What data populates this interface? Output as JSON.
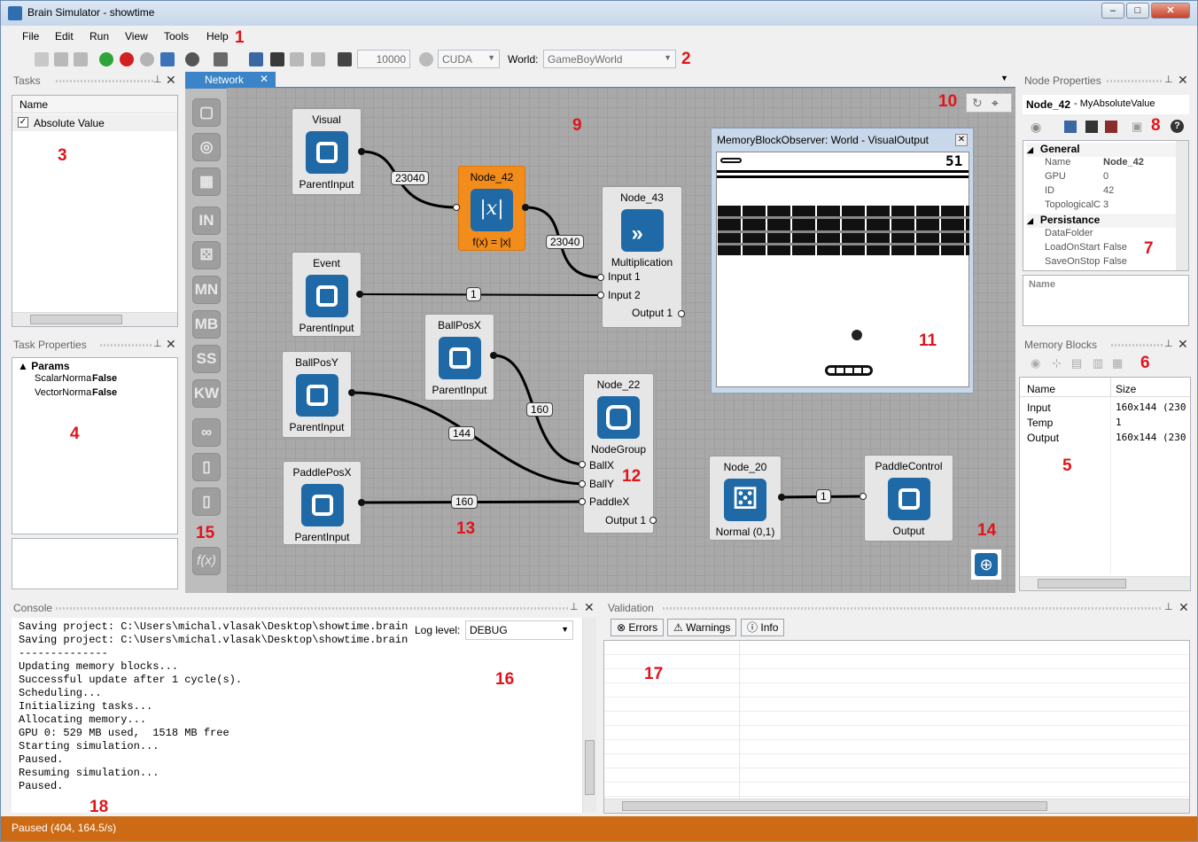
{
  "window": {
    "title": "Brain Simulator - showtime"
  },
  "menu": [
    "File",
    "Edit",
    "Run",
    "View",
    "Tools",
    "Help"
  ],
  "toolbar": {
    "steps": "10000",
    "device": "CUDA",
    "world_label": "World:",
    "world": "GameBoyWorld"
  },
  "tasks": {
    "title": "Tasks",
    "col": "Name",
    "items": [
      {
        "label": "Absolute Value",
        "checked": true
      }
    ]
  },
  "task_props": {
    "title": "Task Properties",
    "group": "Params",
    "rows": [
      {
        "k": "ScalarNorma",
        "v": "False"
      },
      {
        "k": "VectorNorma",
        "v": "False"
      }
    ]
  },
  "doc_tab": {
    "label": "Network"
  },
  "library": [
    "IN",
    "MN",
    "MB",
    "SS",
    "KW"
  ],
  "nodes": {
    "visual": {
      "title": "Visual",
      "label": "ParentInput"
    },
    "event": {
      "title": "Event",
      "label": "ParentInput"
    },
    "ballposy": {
      "title": "BallPosY",
      "label": "ParentInput"
    },
    "ballposx": {
      "title": "BallPosX",
      "label": "ParentInput"
    },
    "paddleposx": {
      "title": "PaddlePosX",
      "label": "ParentInput"
    },
    "n42": {
      "title": "Node_42",
      "label": "f(x) = |x|",
      "icon": "|x|"
    },
    "n43": {
      "title": "Node_43",
      "label": "Multiplication",
      "in1": "Input 1",
      "in2": "Input 2",
      "out": "Output 1"
    },
    "n22": {
      "title": "Node_22",
      "label": "NodeGroup",
      "in1": "BallX",
      "in2": "BallY",
      "in3": "PaddleX",
      "out": "Output 1"
    },
    "n20": {
      "title": "Node_20",
      "label": "Normal (0,1)"
    },
    "paddlecontrol": {
      "title": "PaddleControl",
      "label": "Output"
    }
  },
  "edges": [
    "23040",
    "23040",
    "1",
    "160",
    "144",
    "160",
    "1"
  ],
  "observer": {
    "title": "MemoryBlockObserver: World - VisualOutput",
    "score": "51"
  },
  "node_props": {
    "title": "Node Properties",
    "node": "Node_42",
    "type": " - MyAbsoluteValue",
    "groups": [
      {
        "name": "General",
        "rows": [
          {
            "k": "Name",
            "v": "Node_42",
            "bold": true
          },
          {
            "k": "GPU",
            "v": "0"
          },
          {
            "k": "ID",
            "v": "42"
          },
          {
            "k": "TopologicalC",
            "v": "3"
          }
        ]
      },
      {
        "name": "Persistance",
        "rows": [
          {
            "k": "DataFolder",
            "v": ""
          },
          {
            "k": "LoadOnStart",
            "v": "False"
          },
          {
            "k": "SaveOnStop",
            "v": "False"
          }
        ]
      }
    ],
    "desc_label": "Name"
  },
  "memory": {
    "title": "Memory Blocks",
    "cols": [
      "Name",
      "Size"
    ],
    "rows": [
      {
        "n": "Input",
        "s": "160x144 (230"
      },
      {
        "n": "Temp",
        "s": "1"
      },
      {
        "n": "Output",
        "s": "160x144 (230"
      }
    ]
  },
  "console": {
    "title": "Console",
    "log_label": "Log level:",
    "log_level": "DEBUG",
    "lines": "Saving project: C:\\Users\\michal.vlasak\\Desktop\\showtime.brain\nSaving project: C:\\Users\\michal.vlasak\\Desktop\\showtime.brain\n--------------\nUpdating memory blocks...\nSuccessful update after 1 cycle(s).\nScheduling...\nInitializing tasks...\nAllocating memory...\nGPU 0: 529 MB used,  1518 MB free\nStarting simulation...\nPaused.\nResuming simulation...\nPaused."
  },
  "validation": {
    "title": "Validation",
    "errors": "Errors",
    "warnings": "Warnings",
    "info": "Info"
  },
  "status": {
    "text": "Paused  (404, 164.5/s)"
  },
  "annotations": [
    "1",
    "2",
    "3",
    "4",
    "5",
    "6",
    "7",
    "8",
    "9",
    "10",
    "11",
    "12",
    "13",
    "14",
    "15",
    "16",
    "17",
    "18"
  ],
  "colors": {
    "accent": "#1f6aa6",
    "orange": "#f28c1a",
    "status": "#cc6a16",
    "annotation": "#e0141b"
  }
}
